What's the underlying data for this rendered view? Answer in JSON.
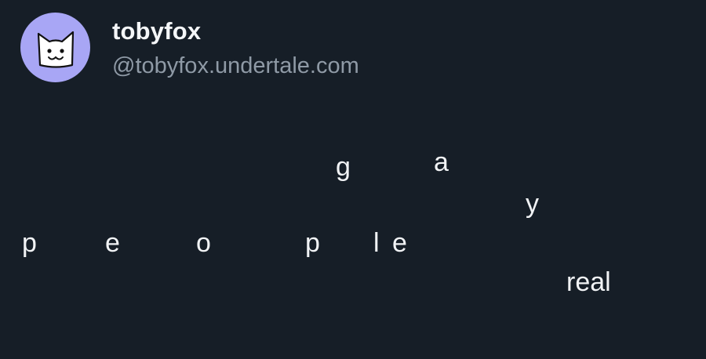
{
  "author": {
    "display_name": "tobyfox",
    "handle": "@tobyfox.undertale.com",
    "avatar_icon": "cat-face-avatar-icon",
    "avatar_bg": "#a8a6f5"
  },
  "post_body": {
    "glyphs": [
      "g",
      "a",
      "y",
      "p",
      "e",
      "o",
      "p",
      "l",
      "e",
      "real"
    ]
  },
  "colors": {
    "background": "#161e27",
    "text": "#f1f3f5",
    "handle": "#8f9aa6"
  }
}
